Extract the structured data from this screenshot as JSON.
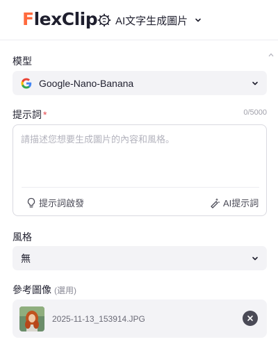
{
  "header": {
    "logo_text_1": "lex",
    "logo_text_2": "Clip",
    "tool_label": "AI文字生成圖片"
  },
  "model": {
    "label": "模型",
    "selected": "Google-Nano-Banana"
  },
  "prompt": {
    "label": "提示詞",
    "required_mark": "*",
    "counter": "0/5000",
    "placeholder": "請描述您想要生成圖片的內容和風格。",
    "inspire_label": "提示詞啟發",
    "ai_label": "AI提示詞"
  },
  "style": {
    "label": "風格",
    "selected": "無"
  },
  "reference": {
    "label": "參考圖像",
    "optional": "(選用)",
    "file_name": "2025-11-13_153914.JPG"
  },
  "colors": {
    "accent": "#ff6a3d",
    "field_bg": "#f3f3f6",
    "required": "#e5484d"
  }
}
